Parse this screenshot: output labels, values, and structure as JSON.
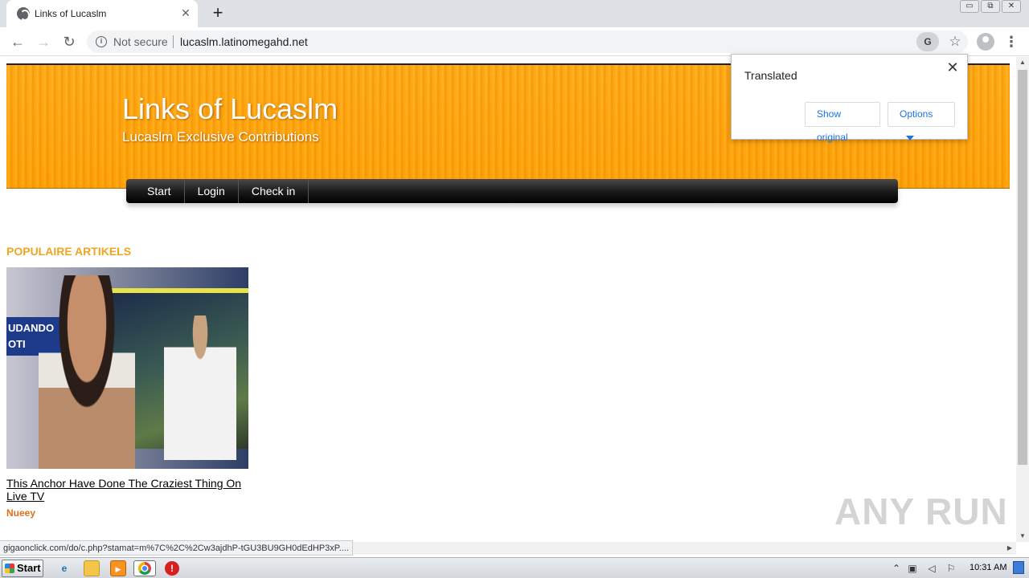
{
  "browser": {
    "tab_title": "Links of Lucaslm",
    "tab_close_glyph": "✕",
    "new_tab_glyph": "+",
    "window_buttons": [
      "▭",
      "⧉",
      "✕"
    ],
    "back_glyph": "←",
    "forward_glyph": "→",
    "reload_glyph": "↻",
    "security_label": "Not secure",
    "url": "lucaslm.latinomegahd.net",
    "star_glyph": "☆",
    "menu_glyph": "⋮"
  },
  "translate_popup": {
    "title": "Translated",
    "close_glyph": "✕",
    "show_original_label": "Show original",
    "options_label": "Options"
  },
  "site": {
    "title": "Links of Lucaslm",
    "subtitle": "Lucaslm Exclusive Contributions",
    "nav": [
      "Start",
      "Login",
      "Check in"
    ],
    "section_heading": "POPULAIRE ARTIKELS",
    "thumb_ticker_text": "UDANDO\nOTI",
    "article": {
      "title": "This Anchor Have Done The Craziest Thing On Live TV",
      "author": "Nueey"
    }
  },
  "status_bar": {
    "link_url": "gigaonclick.com/do/c.php?stamat=m%7C%2C%2Cw3ajdhP-tGU3BU9GH0dEdHP3xP...."
  },
  "watermark": "ANY RUN",
  "taskbar": {
    "start_label": "Start",
    "clock": "10:31 AM"
  },
  "colors": {
    "header_orange": "#ff9f00",
    "section_heading": "#f0a521",
    "author": "#e06f1c",
    "link_blue": "#1a73e8"
  }
}
